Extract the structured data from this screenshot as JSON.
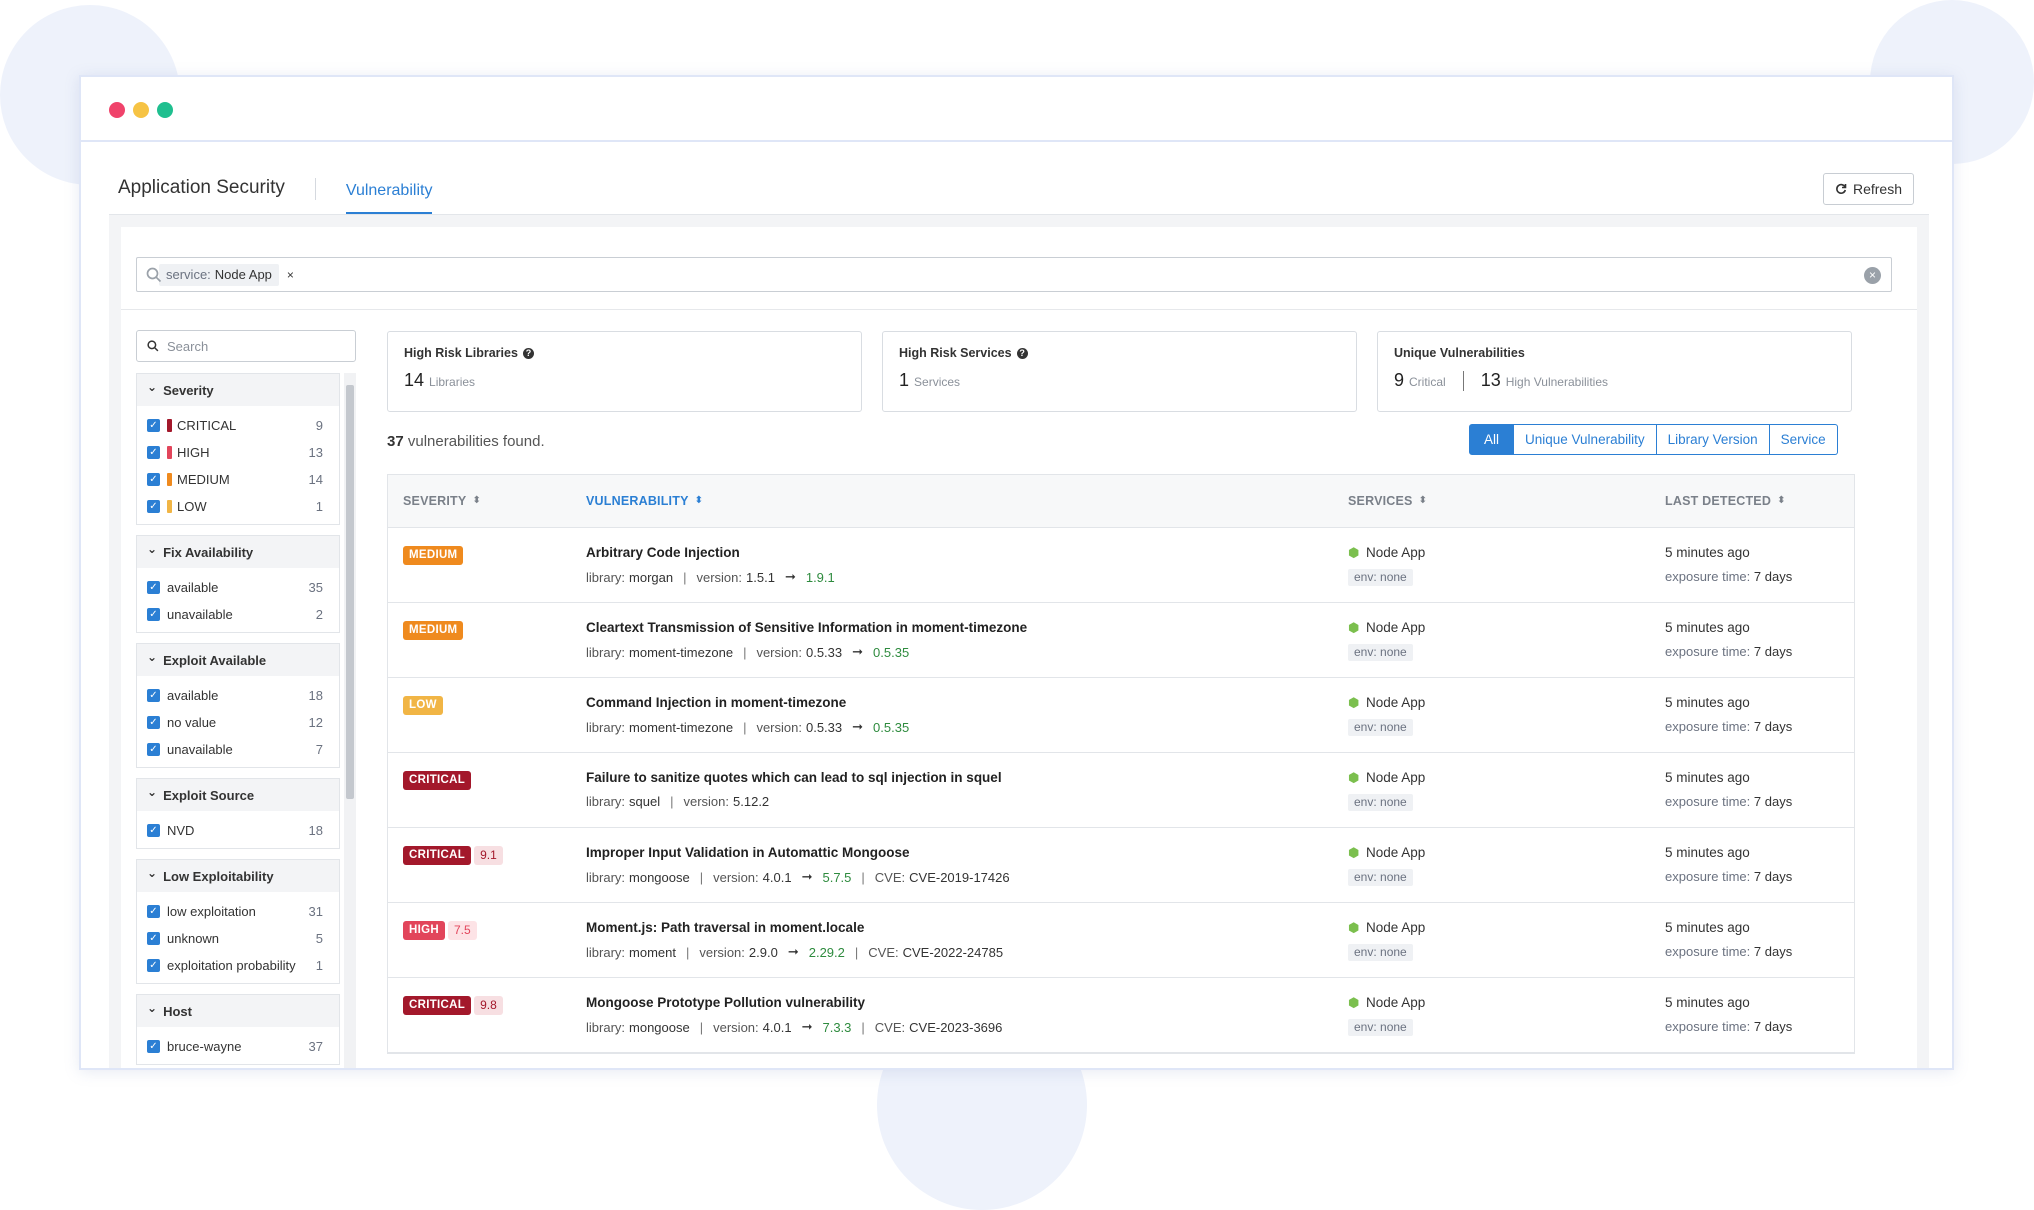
{
  "window": {
    "dots": [
      "#f0436b",
      "#f6c344",
      "#1fbf8f"
    ]
  },
  "header": {
    "brand": "Application Security",
    "active_tab": "Vulnerability",
    "refresh_label": "Refresh"
  },
  "search": {
    "chip_key": "service:",
    "chip_value": "Node App",
    "chip_remove": "×"
  },
  "sidebar": {
    "search_placeholder": "Search",
    "facets": [
      {
        "title": "Severity",
        "items": [
          {
            "label": "CRITICAL",
            "count": "9",
            "color": "#a3182b"
          },
          {
            "label": "HIGH",
            "count": "13",
            "color": "#e2455b"
          },
          {
            "label": "MEDIUM",
            "count": "14",
            "color": "#ef8a1e"
          },
          {
            "label": "LOW",
            "count": "1",
            "color": "#f1b545"
          }
        ]
      },
      {
        "title": "Fix Availability",
        "items": [
          {
            "label": "available",
            "count": "35"
          },
          {
            "label": "unavailable",
            "count": "2"
          }
        ]
      },
      {
        "title": "Exploit Available",
        "items": [
          {
            "label": "available",
            "count": "18"
          },
          {
            "label": "no value",
            "count": "12"
          },
          {
            "label": "unavailable",
            "count": "7"
          }
        ]
      },
      {
        "title": "Exploit Source",
        "items": [
          {
            "label": "NVD",
            "count": "18"
          }
        ]
      },
      {
        "title": "Low Exploitability",
        "items": [
          {
            "label": "low exploitation",
            "count": "31"
          },
          {
            "label": "unknown",
            "count": "5"
          },
          {
            "label": "exploitation probability",
            "count": "1"
          }
        ]
      },
      {
        "title": "Host",
        "items": [
          {
            "label": "bruce-wayne",
            "count": "37"
          }
        ]
      }
    ]
  },
  "cards": {
    "libraries": {
      "title": "High Risk Libraries",
      "value": "14",
      "unit": "Libraries"
    },
    "services": {
      "title": "High Risk Services",
      "value": "1",
      "unit": "Services"
    },
    "unique": {
      "title": "Unique Vulnerabilities",
      "value1": "9",
      "unit1": "Critical",
      "value2": "13",
      "unit2": "High Vulnerabilities"
    }
  },
  "results": {
    "count": "37",
    "suffix": "vulnerabilities found."
  },
  "view_buttons": [
    "All",
    "Unique Vulnerability",
    "Library Version",
    "Service"
  ],
  "table": {
    "columns": [
      "SEVERITY",
      "VULNERABILITY",
      "SERVICES",
      "LAST DETECTED"
    ],
    "labels": {
      "library": "library:",
      "version": "version:",
      "cve": "CVE:",
      "exposure": "exposure time:",
      "sep": "|",
      "arrow": "➞"
    },
    "rows": [
      {
        "severity": "MEDIUM",
        "sev_color": "#ef8a1e",
        "score": "",
        "name": "Arbitrary Code Injection",
        "library": "morgan",
        "version": "1.5.1",
        "fixed": "1.9.1",
        "cve": "",
        "service": "Node App",
        "env": "env: none",
        "last": "5 minutes ago",
        "exposure": "7 days"
      },
      {
        "severity": "MEDIUM",
        "sev_color": "#ef8a1e",
        "score": "",
        "name": "Cleartext Transmission of Sensitive Information in moment-timezone",
        "library": "moment-timezone",
        "version": "0.5.33",
        "fixed": "0.5.35",
        "cve": "",
        "service": "Node App",
        "env": "env: none",
        "last": "5 minutes ago",
        "exposure": "7 days"
      },
      {
        "severity": "LOW",
        "sev_color": "#f1b545",
        "score": "",
        "name": "Command Injection in moment-timezone",
        "library": "moment-timezone",
        "version": "0.5.33",
        "fixed": "0.5.35",
        "cve": "",
        "service": "Node App",
        "env": "env: none",
        "last": "5 minutes ago",
        "exposure": "7 days"
      },
      {
        "severity": "CRITICAL",
        "sev_color": "#a3182b",
        "score": "",
        "name": "Failure to sanitize quotes which can lead to sql injection in squel",
        "library": "squel",
        "version": "5.12.2",
        "fixed": "",
        "cve": "",
        "service": "Node App",
        "env": "env: none",
        "last": "5 minutes ago",
        "exposure": "7 days"
      },
      {
        "severity": "CRITICAL",
        "sev_color": "#a3182b",
        "score": "9.1",
        "name": "Improper Input Validation in Automattic Mongoose",
        "library": "mongoose",
        "version": "4.0.1",
        "fixed": "5.7.5",
        "cve": "CVE-2019-17426",
        "service": "Node App",
        "env": "env: none",
        "last": "5 minutes ago",
        "exposure": "7 days"
      },
      {
        "severity": "HIGH",
        "sev_color": "#e2455b",
        "score": "7.5",
        "name": "Moment.js: Path traversal in moment.locale",
        "library": "moment",
        "version": "2.9.0",
        "fixed": "2.29.2",
        "cve": "CVE-2022-24785",
        "service": "Node App",
        "env": "env: none",
        "last": "5 minutes ago",
        "exposure": "7 days"
      },
      {
        "severity": "CRITICAL",
        "sev_color": "#a3182b",
        "score": "9.8",
        "name": "Mongoose Prototype Pollution vulnerability",
        "library": "mongoose",
        "version": "4.0.1",
        "fixed": "7.3.3",
        "cve": "CVE-2023-3696",
        "service": "Node App",
        "env": "env: none",
        "last": "5 minutes ago",
        "exposure": "7 days"
      }
    ]
  }
}
